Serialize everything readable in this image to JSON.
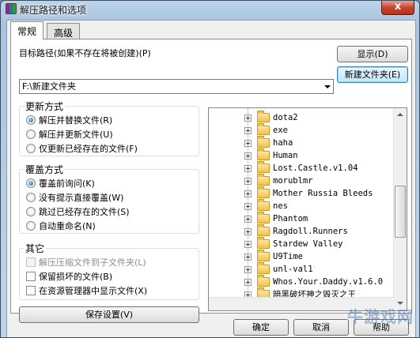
{
  "window": {
    "title": "解压路径和选项",
    "close_label": "x"
  },
  "tabs": [
    {
      "label": "常规",
      "active": true
    },
    {
      "label": "高级",
      "active": false
    }
  ],
  "target": {
    "label": "目标路径(如果不存在将被创建)(P)",
    "value": "F:\\新建文件夹",
    "show_button": "显示(D)",
    "new_folder_button": "新建文件夹(E)"
  },
  "update_mode": {
    "title": "更新方式",
    "options": [
      {
        "label": "解压并替换文件(R)",
        "selected": true
      },
      {
        "label": "解压并更新文件(U)",
        "selected": false
      },
      {
        "label": "仅更新已经存在的文件(F)",
        "selected": false
      }
    ]
  },
  "overwrite_mode": {
    "title": "覆盖方式",
    "options": [
      {
        "label": "覆盖前询问(K)",
        "selected": true
      },
      {
        "label": "没有提示直接覆盖(W)",
        "selected": false
      },
      {
        "label": "跳过已经存在的文件(S)",
        "selected": false
      },
      {
        "label": "自动重命名(N)",
        "selected": false
      }
    ]
  },
  "misc": {
    "title": "其它",
    "options": [
      {
        "label": "解压压缩文件到子文件夹(L)",
        "checked": false,
        "disabled": true
      },
      {
        "label": "保留损坏的文件(B)",
        "checked": false,
        "disabled": false
      },
      {
        "label": "在资源管理器中显示文件(X)",
        "checked": false,
        "disabled": false
      }
    ]
  },
  "save_button": "保存设置(V)",
  "tree": {
    "items": [
      {
        "label": "dota2",
        "selected": false
      },
      {
        "label": "exe",
        "selected": false
      },
      {
        "label": "haha",
        "selected": false
      },
      {
        "label": "Human",
        "selected": false
      },
      {
        "label": "Lost.Castle.v1.04",
        "selected": false
      },
      {
        "label": "morublmr",
        "selected": false
      },
      {
        "label": "Mother Russia Bleeds",
        "selected": false
      },
      {
        "label": "nes",
        "selected": false
      },
      {
        "label": "Phantom",
        "selected": false
      },
      {
        "label": "Ragdoll.Runners",
        "selected": false
      },
      {
        "label": "Stardew Valley",
        "selected": false
      },
      {
        "label": "U9Time",
        "selected": false
      },
      {
        "label": "unl-val1",
        "selected": false
      },
      {
        "label": "Whos.Your.Daddy.v1.6.0",
        "selected": false
      },
      {
        "label": "暗黑破坏神之毁灭之王",
        "selected": false
      },
      {
        "label": "新建文件夹",
        "selected": true
      }
    ]
  },
  "footer": {
    "ok": "确定",
    "cancel": "取消",
    "help": "帮助"
  },
  "watermark": "牛游戏网"
}
